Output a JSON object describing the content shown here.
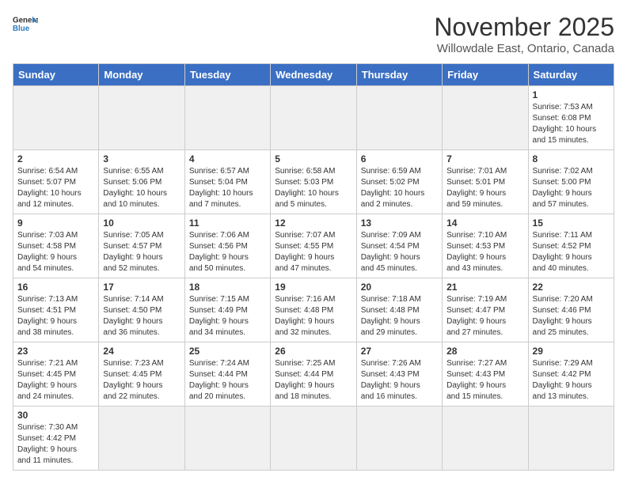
{
  "header": {
    "logo_general": "General",
    "logo_blue": "Blue",
    "month_title": "November 2025",
    "subtitle": "Willowdale East, Ontario, Canada"
  },
  "days_of_week": [
    "Sunday",
    "Monday",
    "Tuesday",
    "Wednesday",
    "Thursday",
    "Friday",
    "Saturday"
  ],
  "weeks": [
    [
      {
        "day": "",
        "info": ""
      },
      {
        "day": "",
        "info": ""
      },
      {
        "day": "",
        "info": ""
      },
      {
        "day": "",
        "info": ""
      },
      {
        "day": "",
        "info": ""
      },
      {
        "day": "",
        "info": ""
      },
      {
        "day": "1",
        "info": "Sunrise: 7:53 AM\nSunset: 6:08 PM\nDaylight: 10 hours\nand 15 minutes."
      }
    ],
    [
      {
        "day": "2",
        "info": "Sunrise: 6:54 AM\nSunset: 5:07 PM\nDaylight: 10 hours\nand 12 minutes."
      },
      {
        "day": "3",
        "info": "Sunrise: 6:55 AM\nSunset: 5:06 PM\nDaylight: 10 hours\nand 10 minutes."
      },
      {
        "day": "4",
        "info": "Sunrise: 6:57 AM\nSunset: 5:04 PM\nDaylight: 10 hours\nand 7 minutes."
      },
      {
        "day": "5",
        "info": "Sunrise: 6:58 AM\nSunset: 5:03 PM\nDaylight: 10 hours\nand 5 minutes."
      },
      {
        "day": "6",
        "info": "Sunrise: 6:59 AM\nSunset: 5:02 PM\nDaylight: 10 hours\nand 2 minutes."
      },
      {
        "day": "7",
        "info": "Sunrise: 7:01 AM\nSunset: 5:01 PM\nDaylight: 9 hours\nand 59 minutes."
      },
      {
        "day": "8",
        "info": "Sunrise: 7:02 AM\nSunset: 5:00 PM\nDaylight: 9 hours\nand 57 minutes."
      }
    ],
    [
      {
        "day": "9",
        "info": "Sunrise: 7:03 AM\nSunset: 4:58 PM\nDaylight: 9 hours\nand 54 minutes."
      },
      {
        "day": "10",
        "info": "Sunrise: 7:05 AM\nSunset: 4:57 PM\nDaylight: 9 hours\nand 52 minutes."
      },
      {
        "day": "11",
        "info": "Sunrise: 7:06 AM\nSunset: 4:56 PM\nDaylight: 9 hours\nand 50 minutes."
      },
      {
        "day": "12",
        "info": "Sunrise: 7:07 AM\nSunset: 4:55 PM\nDaylight: 9 hours\nand 47 minutes."
      },
      {
        "day": "13",
        "info": "Sunrise: 7:09 AM\nSunset: 4:54 PM\nDaylight: 9 hours\nand 45 minutes."
      },
      {
        "day": "14",
        "info": "Sunrise: 7:10 AM\nSunset: 4:53 PM\nDaylight: 9 hours\nand 43 minutes."
      },
      {
        "day": "15",
        "info": "Sunrise: 7:11 AM\nSunset: 4:52 PM\nDaylight: 9 hours\nand 40 minutes."
      }
    ],
    [
      {
        "day": "16",
        "info": "Sunrise: 7:13 AM\nSunset: 4:51 PM\nDaylight: 9 hours\nand 38 minutes."
      },
      {
        "day": "17",
        "info": "Sunrise: 7:14 AM\nSunset: 4:50 PM\nDaylight: 9 hours\nand 36 minutes."
      },
      {
        "day": "18",
        "info": "Sunrise: 7:15 AM\nSunset: 4:49 PM\nDaylight: 9 hours\nand 34 minutes."
      },
      {
        "day": "19",
        "info": "Sunrise: 7:16 AM\nSunset: 4:48 PM\nDaylight: 9 hours\nand 32 minutes."
      },
      {
        "day": "20",
        "info": "Sunrise: 7:18 AM\nSunset: 4:48 PM\nDaylight: 9 hours\nand 29 minutes."
      },
      {
        "day": "21",
        "info": "Sunrise: 7:19 AM\nSunset: 4:47 PM\nDaylight: 9 hours\nand 27 minutes."
      },
      {
        "day": "22",
        "info": "Sunrise: 7:20 AM\nSunset: 4:46 PM\nDaylight: 9 hours\nand 25 minutes."
      }
    ],
    [
      {
        "day": "23",
        "info": "Sunrise: 7:21 AM\nSunset: 4:45 PM\nDaylight: 9 hours\nand 24 minutes."
      },
      {
        "day": "24",
        "info": "Sunrise: 7:23 AM\nSunset: 4:45 PM\nDaylight: 9 hours\nand 22 minutes."
      },
      {
        "day": "25",
        "info": "Sunrise: 7:24 AM\nSunset: 4:44 PM\nDaylight: 9 hours\nand 20 minutes."
      },
      {
        "day": "26",
        "info": "Sunrise: 7:25 AM\nSunset: 4:44 PM\nDaylight: 9 hours\nand 18 minutes."
      },
      {
        "day": "27",
        "info": "Sunrise: 7:26 AM\nSunset: 4:43 PM\nDaylight: 9 hours\nand 16 minutes."
      },
      {
        "day": "28",
        "info": "Sunrise: 7:27 AM\nSunset: 4:43 PM\nDaylight: 9 hours\nand 15 minutes."
      },
      {
        "day": "29",
        "info": "Sunrise: 7:29 AM\nSunset: 4:42 PM\nDaylight: 9 hours\nand 13 minutes."
      }
    ],
    [
      {
        "day": "30",
        "info": "Sunrise: 7:30 AM\nSunset: 4:42 PM\nDaylight: 9 hours\nand 11 minutes."
      },
      {
        "day": "",
        "info": ""
      },
      {
        "day": "",
        "info": ""
      },
      {
        "day": "",
        "info": ""
      },
      {
        "day": "",
        "info": ""
      },
      {
        "day": "",
        "info": ""
      },
      {
        "day": "",
        "info": ""
      }
    ]
  ]
}
